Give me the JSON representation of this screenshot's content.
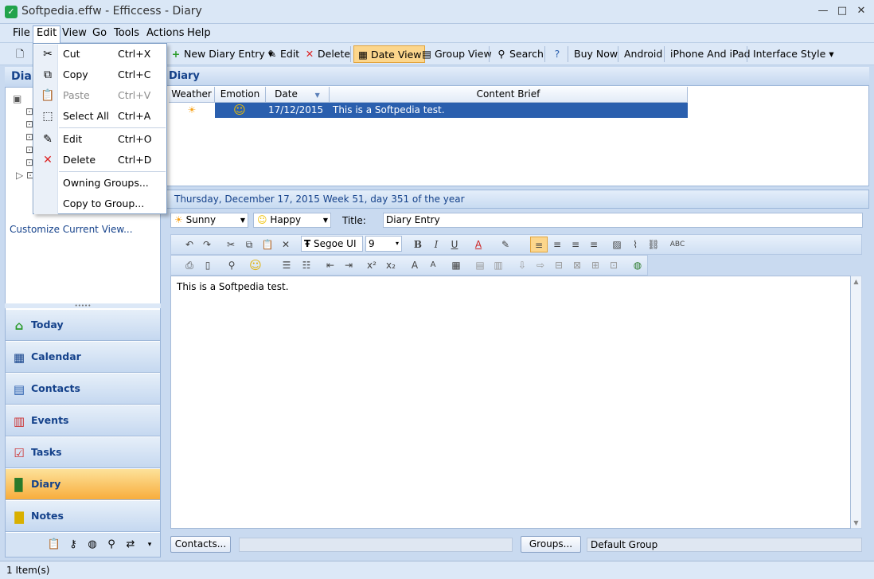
{
  "window": {
    "title": "Softpedia.effw - Efficcess - Diary",
    "min": "—",
    "max": "□",
    "close": "✕",
    "app_glyph": "✓"
  },
  "menubar": {
    "file": "File",
    "edit": "Edit",
    "view": "View",
    "go": "Go",
    "tools": "Tools",
    "actions": "Actions",
    "help": "Help"
  },
  "toolbar": {
    "new_entry": "New Diary Entry",
    "edit": "Edit",
    "delete": "Delete",
    "date_view": "Date View",
    "group_view": "Group View",
    "search": "Search",
    "buy_now": "Buy Now",
    "android": "Android",
    "iphone": "iPhone And iPad",
    "interface_style": "Interface Style"
  },
  "edit_menu": {
    "items": [
      {
        "label": "Cut",
        "shortcut": "Ctrl+X"
      },
      {
        "label": "Copy",
        "shortcut": "Ctrl+C"
      },
      {
        "label": "Paste",
        "shortcut": "Ctrl+V"
      },
      {
        "label": "Select All",
        "shortcut": "Ctrl+A"
      },
      {
        "label": "Edit",
        "shortcut": "Ctrl+O"
      },
      {
        "label": "Delete",
        "shortcut": "Ctrl+D"
      },
      {
        "label": "Owning Groups..."
      },
      {
        "label": "Copy to Group..."
      }
    ]
  },
  "left_pane": {
    "header": "Diar",
    "customize": "Customize Current View...",
    "nav": [
      "Today",
      "Calendar",
      "Contacts",
      "Events",
      "Tasks",
      "Diary",
      "Notes"
    ],
    "active": "Diary"
  },
  "diary_list": {
    "header": "Diary",
    "columns": [
      "Weather",
      "Emotion",
      "Date",
      "Content Brief"
    ],
    "rows": [
      {
        "weather": "☀",
        "emotion": "☺",
        "date": "17/12/2015",
        "brief": "This is a Softpedia test."
      }
    ]
  },
  "entry": {
    "date_line": "Thursday, December 17, 2015   Week 51, day 351 of the year",
    "weather": "Sunny",
    "emotion": "Happy",
    "title_label": "Title:",
    "title_value": "Diary Entry",
    "font": "Segoe UI",
    "size": "9",
    "body": "This is a Softpedia test."
  },
  "bottom": {
    "contacts_btn": "Contacts...",
    "groups_btn": "Groups...",
    "group_value": "Default Group"
  },
  "status": {
    "text": "1 Item(s)"
  }
}
